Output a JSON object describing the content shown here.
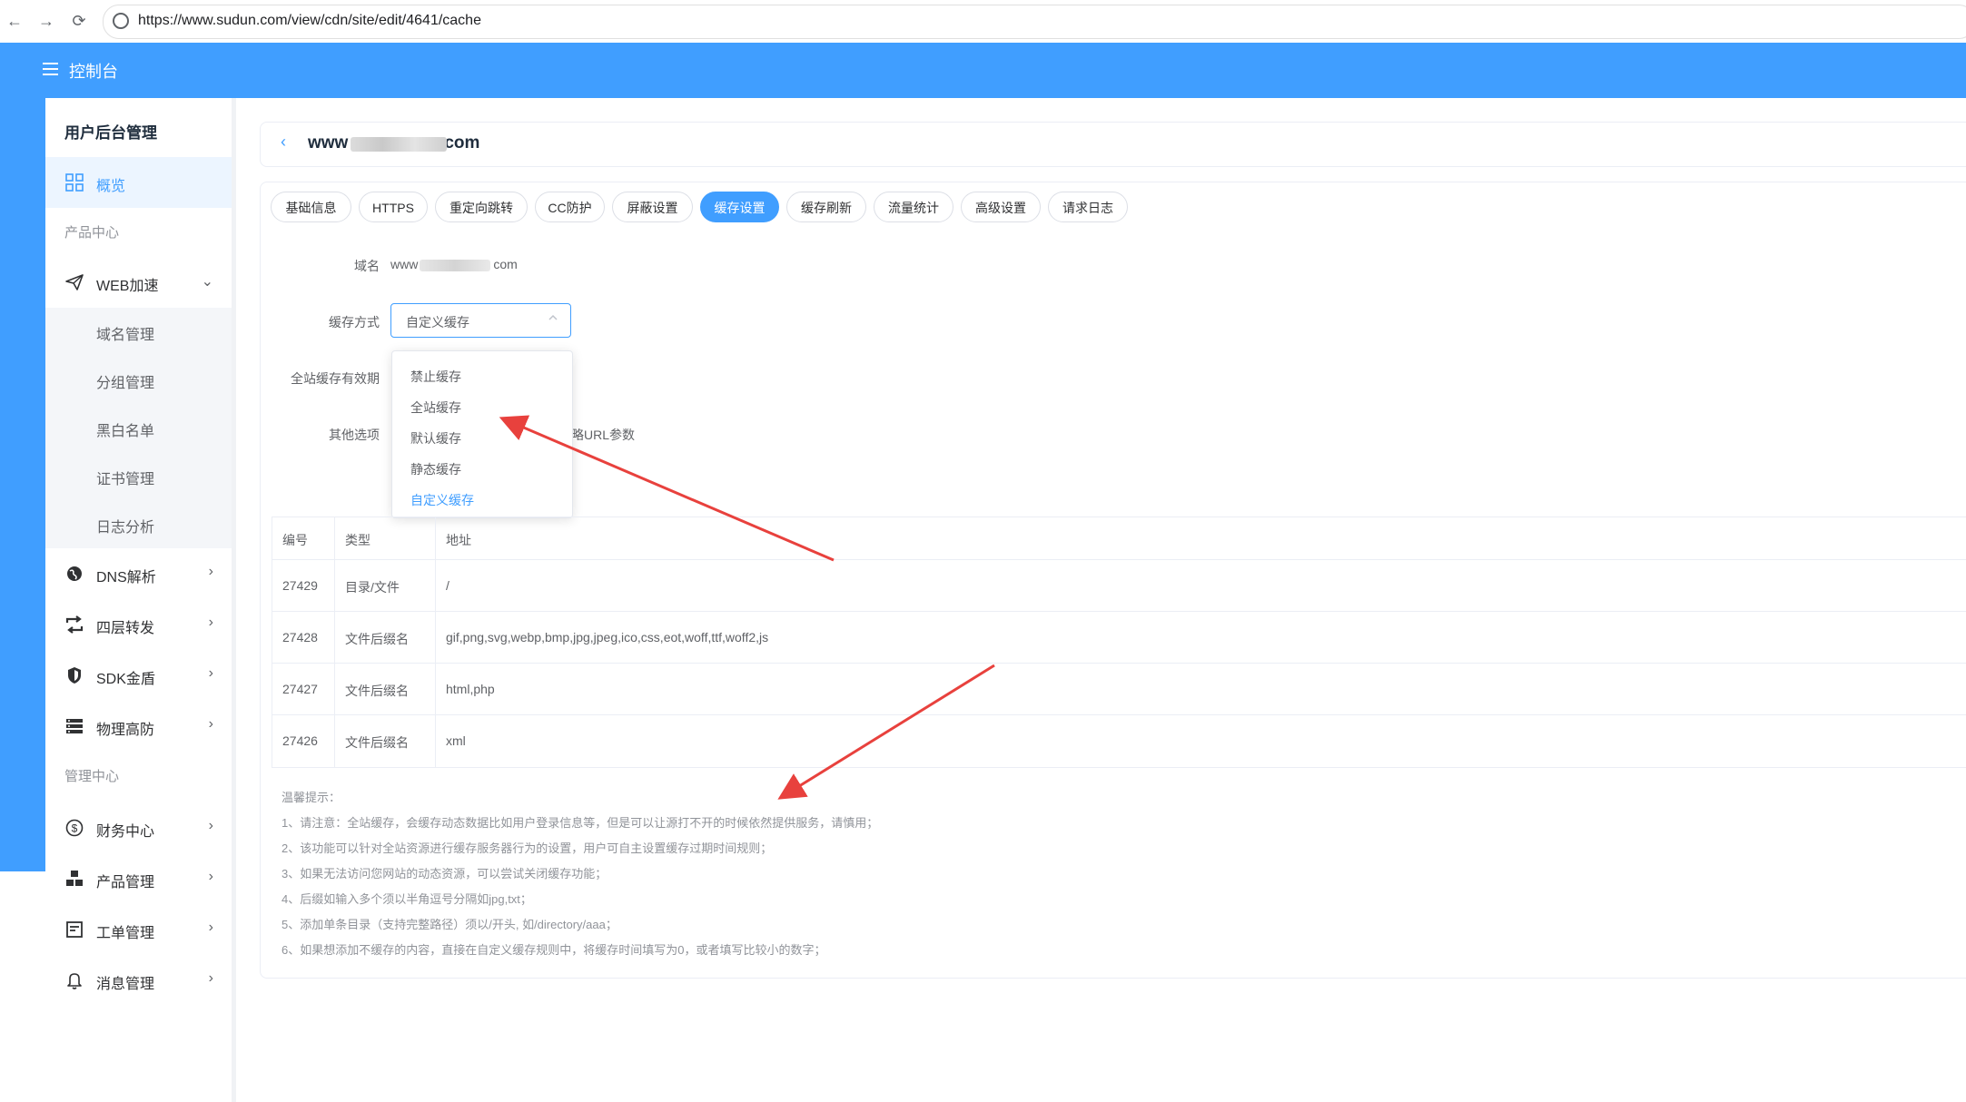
{
  "browser": {
    "url": "https://www.sudun.com/view/cdn/site/edit/4641/cache",
    "nav": {
      "back": "←",
      "forward": "→",
      "reload": "⟳"
    }
  },
  "header": {
    "title": "控制台"
  },
  "sidebar": {
    "title": "用户后台管理",
    "overview": "概览",
    "group_product": "产品中心",
    "web_accel": "WEB加速",
    "web_sub": [
      "域名管理",
      "分组管理",
      "黑白名单",
      "证书管理",
      "日志分析"
    ],
    "items": [
      {
        "label": "DNS解析"
      },
      {
        "label": "四层转发"
      },
      {
        "label": "SDK金盾"
      },
      {
        "label": "物理高防"
      }
    ],
    "group_manage": "管理中心",
    "manage_items": [
      {
        "label": "财务中心"
      },
      {
        "label": "产品管理"
      },
      {
        "label": "工单管理"
      },
      {
        "label": "消息管理"
      }
    ]
  },
  "page": {
    "back_icon": "‹",
    "site_prefix": "www",
    "site_suffix": "com"
  },
  "tabs": [
    "基础信息",
    "HTTPS",
    "重定向跳转",
    "CC防护",
    "屏蔽设置",
    "缓存设置",
    "缓存刷新",
    "流量统计",
    "高级设置",
    "请求日志"
  ],
  "active_tab": "缓存设置",
  "form": {
    "domain_label": "域名",
    "domain_prefix": "www",
    "domain_suffix": "com",
    "cache_mode_label": "缓存方式",
    "cache_mode_value": "自定义缓存",
    "ttl_label": "全站缓存有效期",
    "other_label": "其他选项",
    "other_hidden_text": "略URL参数"
  },
  "dropdown": {
    "options": [
      "禁止缓存",
      "全站缓存",
      "默认缓存",
      "静态缓存",
      "自定义缓存"
    ],
    "selected": "自定义缓存"
  },
  "table": {
    "headers": [
      "编号",
      "类型",
      "地址"
    ],
    "rows": [
      {
        "id": "27429",
        "type": "目录/文件",
        "addr": "/"
      },
      {
        "id": "27428",
        "type": "文件后缀名",
        "addr": "gif,png,svg,webp,bmp,jpg,jpeg,ico,css,eot,woff,ttf,woff2,js"
      },
      {
        "id": "27427",
        "type": "文件后缀名",
        "addr": "html,php"
      },
      {
        "id": "27426",
        "type": "文件后缀名",
        "addr": "xml"
      }
    ]
  },
  "tips": {
    "title": "温馨提示：",
    "lines": [
      "1、请注意：全站缓存，会缓存动态数据比如用户登录信息等，但是可以让源打不开的时候依然提供服务，请慎用；",
      "2、该功能可以针对全站资源进行缓存服务器行为的设置，用户可自主设置缓存过期时间规则；",
      "3、如果无法访问您网站的动态资源，可以尝试关闭缓存功能；",
      "4、后缀如输入多个须以半角逗号分隔如jpg,txt；",
      "5、添加单条目录（支持完整路径）须以/开头, 如/directory/aaa；",
      "6、如果想添加不缓存的内容，直接在自定义缓存规则中，将缓存时间填写为0，或者填写比较小的数字；"
    ]
  },
  "colors": {
    "primary": "#409eff",
    "arrow": "#e8413d"
  }
}
